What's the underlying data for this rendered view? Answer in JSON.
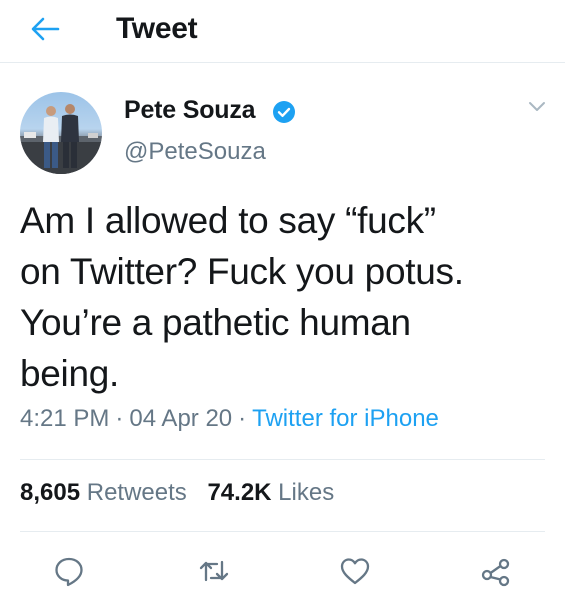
{
  "header": {
    "back_icon": "arrow-left-icon",
    "title": "Tweet"
  },
  "author": {
    "display_name": "Pete Souza",
    "handle": "@PeteSouza",
    "verified": true
  },
  "tweet": {
    "text": "Am I allowed to say “fuck”\non Twitter? Fuck you potus.\nYou’re a pathetic human\nbeing.",
    "time": "4:21 PM",
    "date": "04 Apr 20",
    "separator": "·",
    "source": "Twitter for iPhone"
  },
  "stats": {
    "retweets_count": "8,605",
    "retweets_label": "Retweets",
    "likes_count": "74.2K",
    "likes_label": "Likes"
  },
  "actions": [
    "reply-icon",
    "retweet-icon",
    "like-icon",
    "share-icon"
  ],
  "colors": {
    "accent": "#1da1f2",
    "secondary_text": "#657786",
    "icon_gray": "#657786",
    "divider": "#e6ecf0"
  }
}
